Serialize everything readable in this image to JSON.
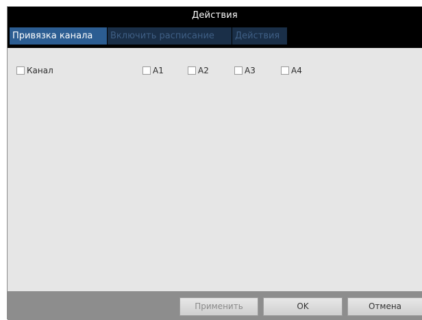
{
  "window": {
    "title": "Действия"
  },
  "tabs": [
    {
      "label": "Привязка канала",
      "active": true
    },
    {
      "label": "Включить расписание",
      "active": false
    },
    {
      "label": "Действия",
      "active": false
    }
  ],
  "checkboxes": [
    {
      "label": "Канал",
      "checked": false
    },
    {
      "label": "A1",
      "checked": false
    },
    {
      "label": "A2",
      "checked": false
    },
    {
      "label": "A3",
      "checked": false
    },
    {
      "label": "A4",
      "checked": false
    }
  ],
  "footer": {
    "apply_label": "Применить",
    "ok_label": "OK",
    "cancel_label": "Отмена"
  },
  "colors": {
    "titlebar_bg": "#000000",
    "tab_active_bg": "#2c5d92",
    "tab_inactive_bg": "#1a2f48",
    "content_bg": "#e6e6e6",
    "footer_bg": "#8d8d8d"
  }
}
